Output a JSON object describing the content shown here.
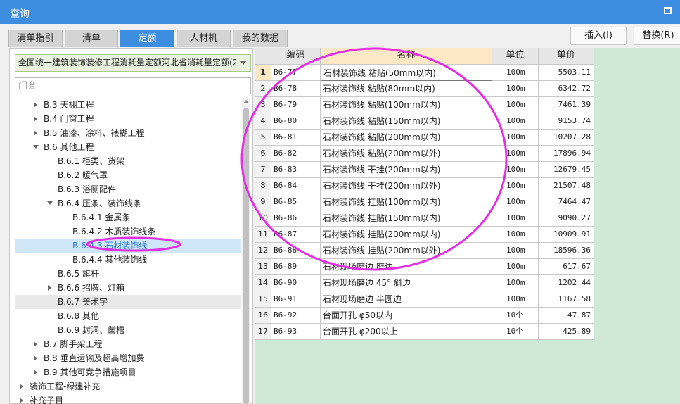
{
  "window": {
    "title": "查询",
    "maximize_icon": "maximize-icon"
  },
  "tabs": [
    {
      "label": "清单指引",
      "active": false
    },
    {
      "label": "清单",
      "active": false
    },
    {
      "label": "定额",
      "active": true
    },
    {
      "label": "人材机",
      "active": false
    },
    {
      "label": "我的数据",
      "active": false
    }
  ],
  "buttons": {
    "insert": "插入(I)",
    "replace": "替换(R)"
  },
  "library": {
    "selected": "全国统一建筑装饰装修工程消耗量定额河北省消耗量定额(20",
    "arrow_icon": "dropdown-arrow-icon"
  },
  "search": {
    "placeholder": "门套",
    "value": ""
  },
  "tree": [
    {
      "label": "B.3 天棚工程",
      "level": 1,
      "toggle": "collapsed"
    },
    {
      "label": "B.4 门窗工程",
      "level": 1,
      "toggle": "collapsed"
    },
    {
      "label": "B.5 油漆、涂料、裱糊工程",
      "level": 1,
      "toggle": "collapsed"
    },
    {
      "label": "B.6 其他工程",
      "level": 1,
      "toggle": "expanded"
    },
    {
      "label": "B.6.1 柜类、货架",
      "level": 2,
      "toggle": "none"
    },
    {
      "label": "B.6.2 暖气罩",
      "level": 2,
      "toggle": "none"
    },
    {
      "label": "B.6.3 浴厕配件",
      "level": 2,
      "toggle": "none"
    },
    {
      "label": "B.6.4 压条、装饰线条",
      "level": 2,
      "toggle": "expanded"
    },
    {
      "label": "B.6.4.1 金属条",
      "level": 3,
      "toggle": "none"
    },
    {
      "label": "B.6.4.2 木质装饰线条",
      "level": 3,
      "toggle": "none"
    },
    {
      "label": "B.6.4.3 石材装饰线",
      "level": 3,
      "toggle": "none",
      "selected": true
    },
    {
      "label": "B.6.4.4 其他装饰线",
      "level": 3,
      "toggle": "none"
    },
    {
      "label": "B.6.5 旗杆",
      "level": 2,
      "toggle": "none"
    },
    {
      "label": "B.6.6 招牌、灯箱",
      "level": 2,
      "toggle": "collapsed"
    },
    {
      "label": "B.6.7 美术字",
      "level": 2,
      "toggle": "none",
      "hover": true
    },
    {
      "label": "B.6.8 其他",
      "level": 2,
      "toggle": "none"
    },
    {
      "label": "B.6.9 封洞、凿槽",
      "level": 2,
      "toggle": "none"
    },
    {
      "label": "B.7 脚手架工程",
      "level": 1,
      "toggle": "collapsed"
    },
    {
      "label": "B.8 垂直运输及超高增加费",
      "level": 1,
      "toggle": "collapsed"
    },
    {
      "label": "B.9 其他可竞争措施项目",
      "level": 1,
      "toggle": "collapsed"
    },
    {
      "label": "装饰工程-绿建补充",
      "level": 0,
      "toggle": "collapsed"
    },
    {
      "label": "补充子目",
      "level": 0,
      "toggle": "collapsed"
    }
  ],
  "table": {
    "headers": {
      "code": "编码",
      "name": "名称",
      "unit": "单位",
      "price": "单价"
    },
    "current_row": 1,
    "rows": [
      {
        "num": "1",
        "code": "B6-77",
        "name": "石材装饰线 粘贴(50mm以内)",
        "unit": "100m",
        "price": "5503.11"
      },
      {
        "num": "2",
        "code": "B6-78",
        "name": "石材装饰线 粘贴(80mm以内)",
        "unit": "100m",
        "price": "6342.72"
      },
      {
        "num": "3",
        "code": "B6-79",
        "name": "石材装饰线 粘贴(100mm以内)",
        "unit": "100m",
        "price": "7461.39"
      },
      {
        "num": "4",
        "code": "B6-80",
        "name": "石材装饰线 粘贴(150mm以内)",
        "unit": "100m",
        "price": "9153.74"
      },
      {
        "num": "5",
        "code": "B6-81",
        "name": "石材装饰线 粘贴(200mm以内)",
        "unit": "100m",
        "price": "10207.28"
      },
      {
        "num": "6",
        "code": "B6-82",
        "name": "石材装饰线 粘贴(200mm以外)",
        "unit": "100m",
        "price": "17896.94"
      },
      {
        "num": "7",
        "code": "B6-83",
        "name": "石材装饰线 干挂(200mm以内)",
        "unit": "100m",
        "price": "12679.45"
      },
      {
        "num": "8",
        "code": "B6-84",
        "name": "石材装饰线 干挂(200mm以外)",
        "unit": "100m",
        "price": "21507.48"
      },
      {
        "num": "9",
        "code": "B6-85",
        "name": "石材装饰线 挂贴(100mm以内)",
        "unit": "100m",
        "price": "7464.47"
      },
      {
        "num": "10",
        "code": "B6-86",
        "name": "石材装饰线 挂贴(150mm以内)",
        "unit": "100m",
        "price": "9090.27"
      },
      {
        "num": "11",
        "code": "B6-87",
        "name": "石材装饰线 挂贴(200mm以内)",
        "unit": "100m",
        "price": "10909.91"
      },
      {
        "num": "12",
        "code": "B6-88",
        "name": "石材装饰线 挂贴(200mm以外)",
        "unit": "100m",
        "price": "18596.36"
      },
      {
        "num": "13",
        "code": "B6-89",
        "name": "石材现场磨边 磨边",
        "unit": "100m",
        "price": "617.67"
      },
      {
        "num": "14",
        "code": "B6-90",
        "name": "石材现场磨边 45° 斜边",
        "unit": "100m",
        "price": "1202.44"
      },
      {
        "num": "15",
        "code": "B6-91",
        "name": "石材现场磨边 半圆边",
        "unit": "100m",
        "price": "1167.58"
      },
      {
        "num": "16",
        "code": "B6-92",
        "name": "台面开孔 φ50以内",
        "unit": "10个",
        "price": "47.87"
      },
      {
        "num": "17",
        "code": "B6-93",
        "name": "台面开孔 φ200以上",
        "unit": "10个",
        "price": "425.89"
      }
    ]
  },
  "colors": {
    "accent": "#3d8ee0",
    "annotation": "#e22fe2",
    "empty_area": "#cfe9d6"
  }
}
